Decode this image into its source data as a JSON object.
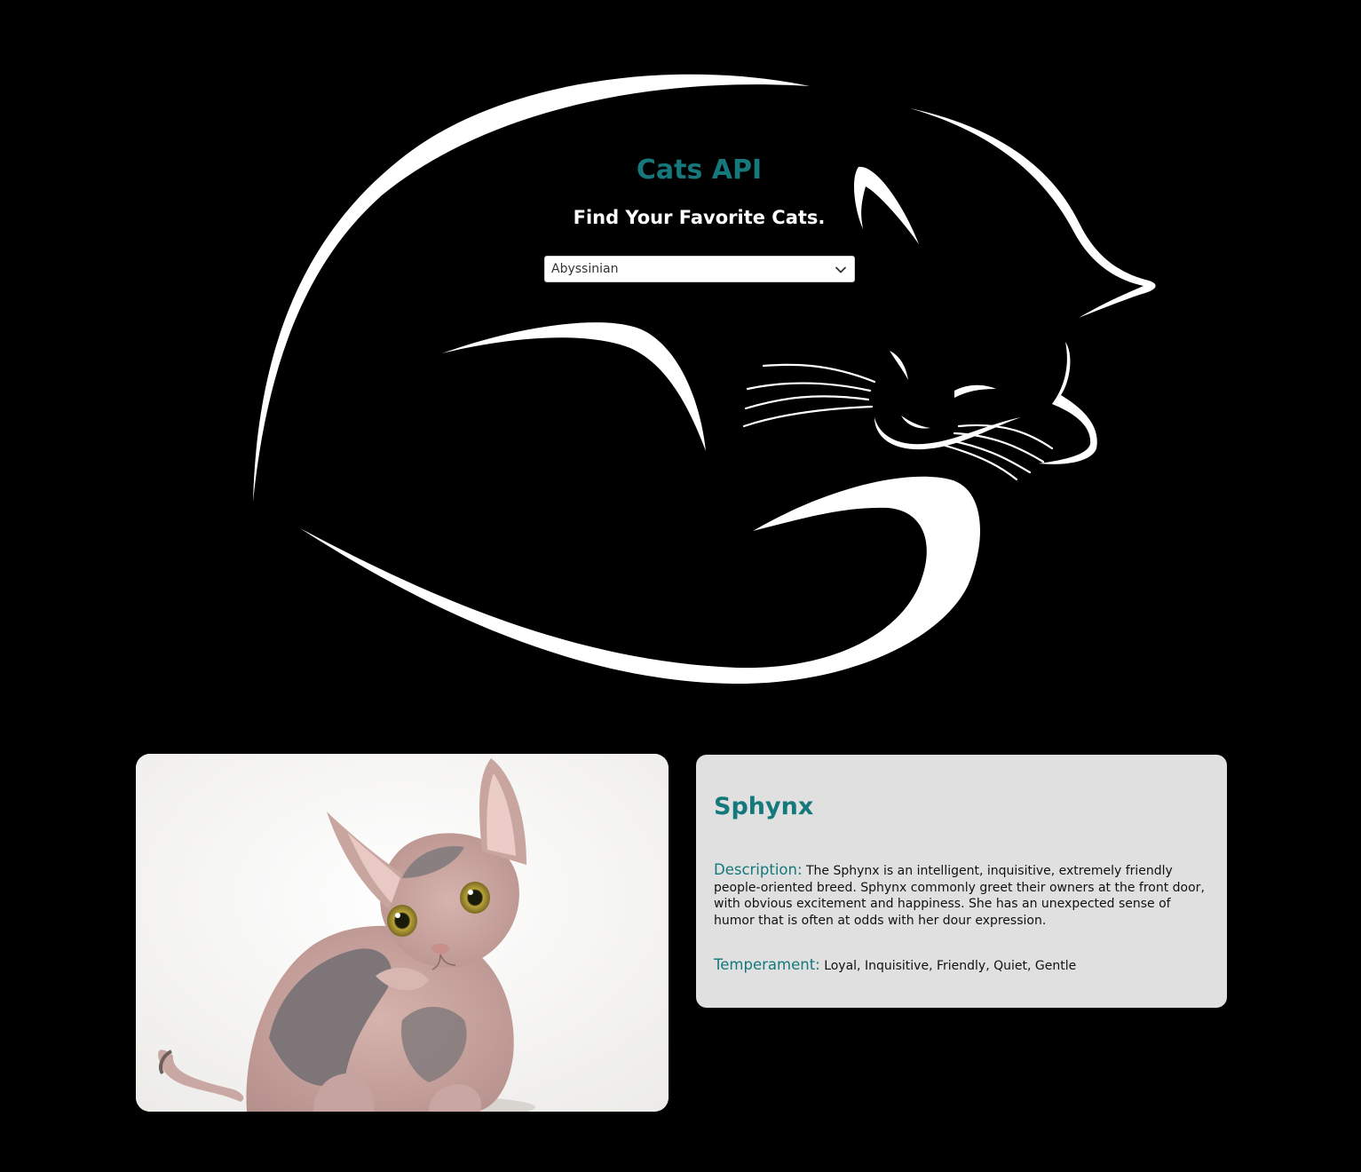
{
  "header": {
    "title": "Cats API",
    "subtitle": "Find Your Favorite Cats."
  },
  "breed_select": {
    "selected": "Abyssinian",
    "icon": "chevron-down-icon"
  },
  "breed": {
    "name": "Sphynx",
    "description_label": "Description:",
    "description": "The Sphynx is an intelligent, inquisitive, extremely friendly people-oriented breed. Sphynx commonly greet their owners at the front door, with obvious excitement and happiness. She has an unexpected sense of humor that is often at odds with her dour expression.",
    "temperament_label": "Temperament:",
    "temperament": "Loyal, Inquisitive, Friendly, Quiet, Gentle"
  },
  "colors": {
    "background": "#000000",
    "accent": "#15787c",
    "card": "#e0e0e0",
    "hero_line": "#ffffff"
  }
}
